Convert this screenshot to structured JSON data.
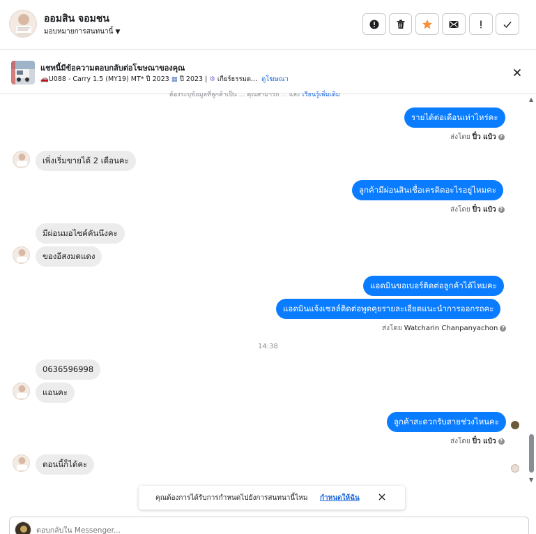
{
  "header": {
    "contact_name": "ออมสิน จอมชน",
    "assign_label": "มอบหมายการสนทนานี้",
    "toolbar_icons": [
      "alert-icon",
      "trash-icon",
      "star-icon",
      "mark-unread-icon",
      "exclamation-icon",
      "check-icon"
    ],
    "star_color": "#f7923a"
  },
  "ad": {
    "title": "แชทนี้มีข้อความตอบกลับต่อโฆษณาของคุณ",
    "model": "U088 - Carry 1.5 (MY19) MT* ปี 2023",
    "year": "ปี 2023 |",
    "transmission": "เกียร์ธรรมด...",
    "view_ad": "ดูโฆษณา"
  },
  "chat": {
    "truncated_text": "ต้องระบุข้อมูลที่ลูกค้าเป็น ... คุณสามารถ ... และ",
    "truncated_link": "เรียนรู้เพิ่มเติม",
    "messages": [
      {
        "text": "รายได้ต่อเดือนเท่าไหร่คะ",
        "sent_label": "ส่งโดย",
        "sender": "ปิ๋ว แป๋ว"
      },
      {
        "text": "เพิ่งเริ่มขายได้ 2 เดือนคะ"
      },
      {
        "text": "ลูกค้ามีผ่อนสินเชื่อเครดิตอะไรอยู่ไหมคะ",
        "sent_label": "ส่งโดย",
        "sender": "ปิ๋ว แป๋ว"
      },
      {
        "text": "มีผ่อนมอไซค์คันนึงคะ"
      },
      {
        "text": "ของอีสงมดแดง"
      },
      {
        "text": "แอดมินขอเบอร์ติดต่อลูกค้าได้ไหมคะ"
      },
      {
        "text": "แอดมินแจ้งเซลล์ติดต่อพูดคุยรายละเอียดแนะนำการออกรถคะ",
        "sent_label": "ส่งโดย",
        "sender": "Watcharin Chanpanyachon"
      },
      {
        "text": "0636596998"
      },
      {
        "text": "แอนคะ"
      },
      {
        "text": "ลูกค้าสะดวกรับสายช่วงไหนคะ",
        "sent_label": "ส่งโดย",
        "sender": "ปิ๋ว แป๋ว"
      },
      {
        "text": "ตอนนี้ก็ได้คะ"
      }
    ],
    "timestamp": "14:38",
    "outgoing_color": "#0a7cff",
    "incoming_color": "#ececec"
  },
  "toast": {
    "text": "คุณต้องการได้รับการกำหนดไปยังการสนทนานี้ไหม",
    "link": "กำหนดให้ฉัน"
  },
  "composer": {
    "placeholder": "ตอบกลับใน Messenger..."
  }
}
